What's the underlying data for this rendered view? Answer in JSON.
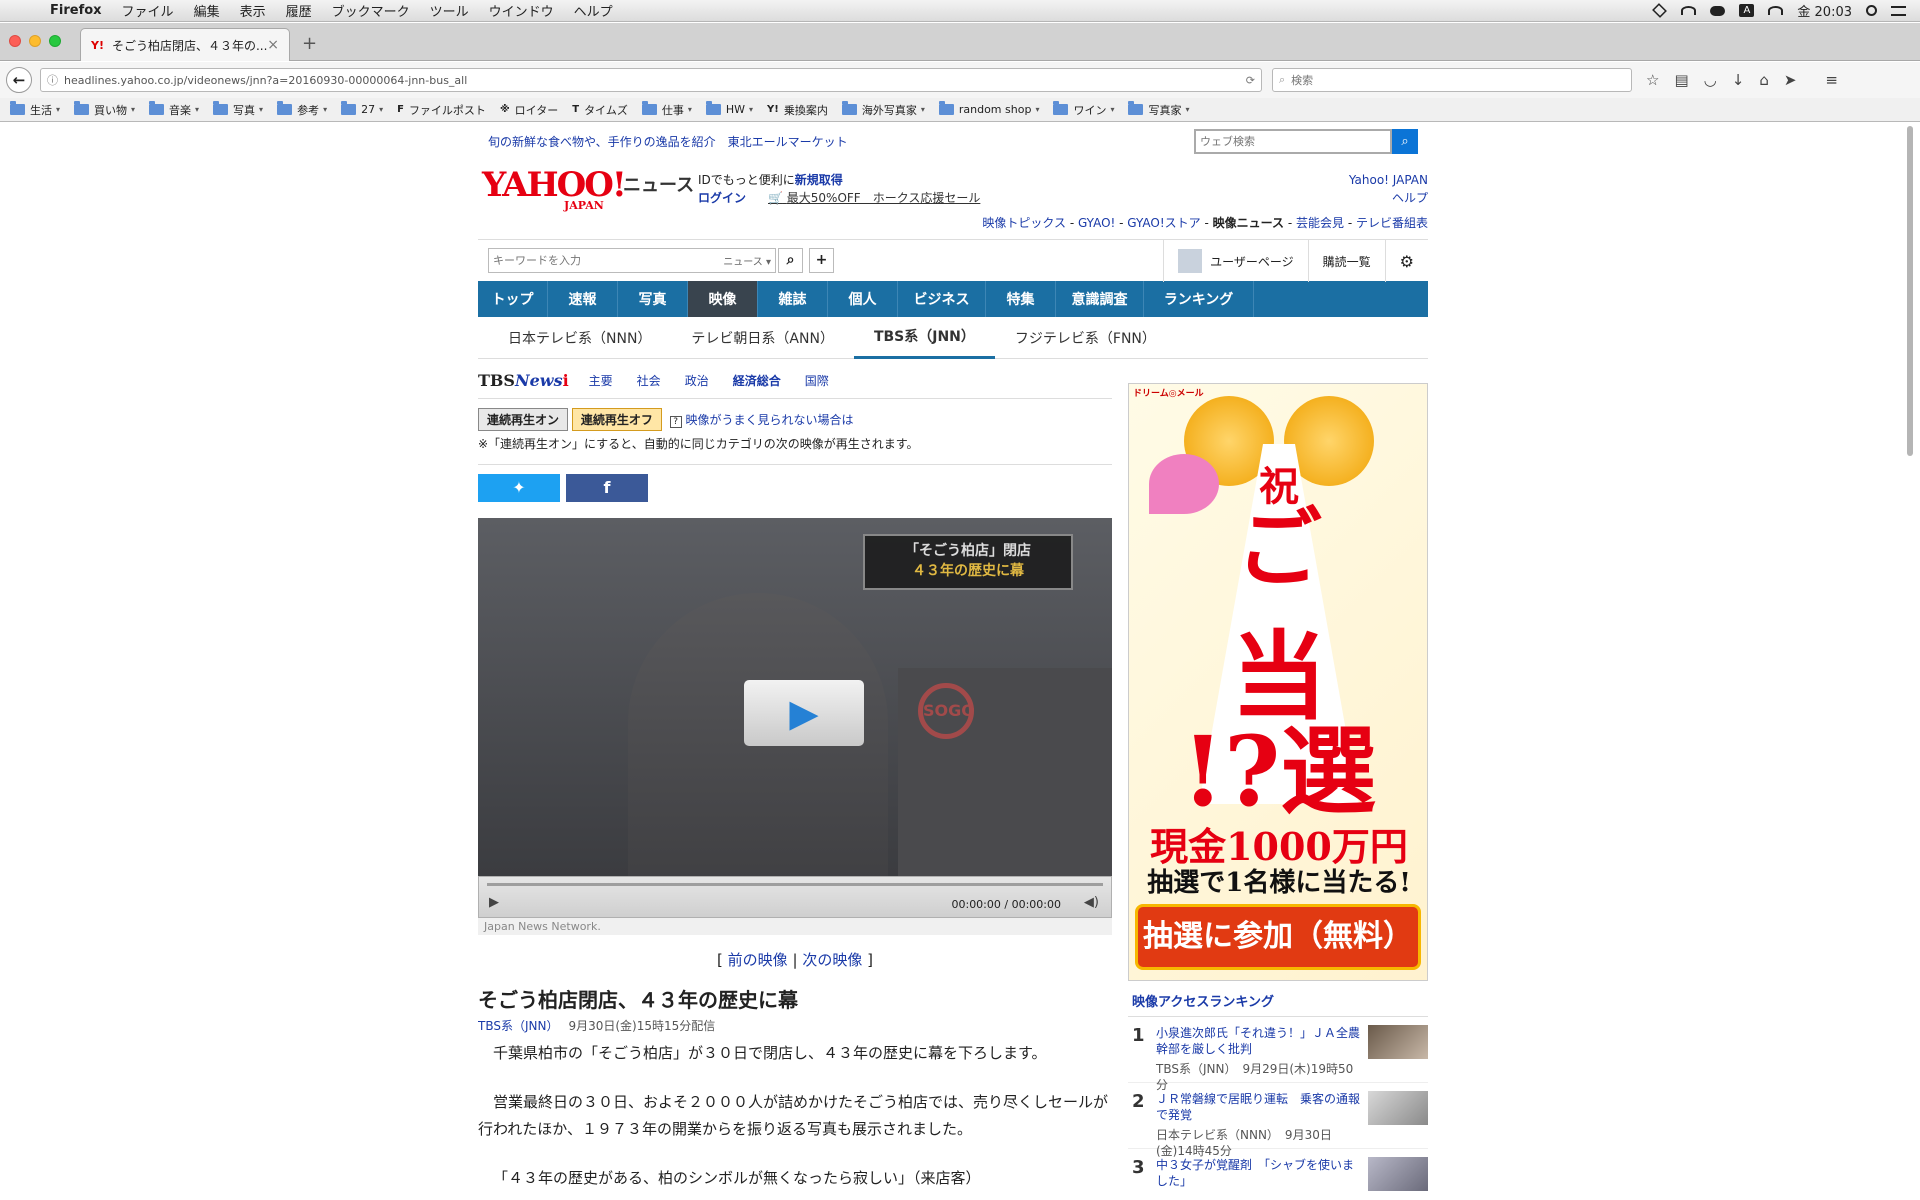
{
  "macbar": {
    "app": "Firefox",
    "menus": [
      "ファイル",
      "編集",
      "表示",
      "履歴",
      "ブックマーク",
      "ツール",
      "ウインドウ",
      "ヘルプ"
    ],
    "clock": "金 20:03",
    "input_icon": "A"
  },
  "browser": {
    "tab_title": "そごう柏店閉店、４３年の...",
    "favicon": "Y!",
    "url": "headlines.yahoo.co.jp/videonews/jnn?a=20160930-00000064-jnn-bus_all",
    "search_placeholder": "検索",
    "bookmarks": [
      {
        "label": "生活",
        "type": "folder"
      },
      {
        "label": "買い物",
        "type": "folder"
      },
      {
        "label": "音楽",
        "type": "folder"
      },
      {
        "label": "写真",
        "type": "folder"
      },
      {
        "label": "参考",
        "type": "folder"
      },
      {
        "label": "27",
        "type": "folder"
      },
      {
        "label": "ファイルポスト",
        "type": "site",
        "fav": "F"
      },
      {
        "label": "ロイター",
        "type": "site",
        "fav": "※"
      },
      {
        "label": "タイムズ",
        "type": "site",
        "fav": "T"
      },
      {
        "label": "仕事",
        "type": "folder"
      },
      {
        "label": "HW",
        "type": "folder"
      },
      {
        "label": "乗換案内",
        "type": "site",
        "fav": "Y!"
      },
      {
        "label": "海外写真家",
        "type": "folder"
      },
      {
        "label": "random shop",
        "type": "folder"
      },
      {
        "label": "ワイン",
        "type": "folder"
      },
      {
        "label": "写真家",
        "type": "folder"
      }
    ]
  },
  "promo": {
    "text": "旬の新鮮な食べ物や、手作りの逸品を紹介　東北エールマーケット",
    "websearch_placeholder": "ウェブ検索"
  },
  "header": {
    "logo": "YAHOO!",
    "logo_sub": "JAPAN",
    "service": "ニュース",
    "id_text": "IDでもっと便利に",
    "register": "新規取得",
    "login": "ログイン",
    "sale": "最大50%OFF　ホークス応援セール",
    "yahoo_japan": "Yahoo! JAPAN",
    "help": "ヘルプ",
    "links": [
      "映像トピックス",
      "GYAO!",
      "GYAO!ストア",
      "映像ニュース",
      "芸能会見",
      "テレビ番組表"
    ],
    "separator": " - "
  },
  "search": {
    "placeholder": "キーワードを入力",
    "category": "ニュース",
    "user_page": "ユーザーページ",
    "subscriptions": "購読一覧"
  },
  "mainnav": [
    "トップ",
    "速報",
    "写真",
    "映像",
    "雑誌",
    "個人",
    "ビジネス",
    "特集",
    "意識調査",
    "ランキング"
  ],
  "subnav": [
    "日本テレビ系（NNN）",
    "テレビ朝日系（ANN）",
    "TBS系（JNN）",
    "フジテレビ系（FNN）"
  ],
  "tbs": {
    "logo_a": "TBS",
    "logo_b": "News",
    "logo_c": "i",
    "categories": [
      "主要",
      "社会",
      "政治",
      "経済総合",
      "国際"
    ]
  },
  "playback": {
    "on": "連続再生オン",
    "off": "連続再生オフ",
    "help_link": "映像がうまく見られない場合は",
    "note": "※「連続再生オン」にすると、自動的に同じカテゴリの次の映像が再生されます。"
  },
  "video": {
    "caption_line1": "「そごう柏店」閉店",
    "caption_line2": "４３年の歴史に幕",
    "sign": "SOGO",
    "time": "00:00:00 / 00:00:00",
    "credit": "Japan News Network."
  },
  "pager": {
    "open": "[",
    "prev": "前の映像",
    "sep": "|",
    "next": "次の映像",
    "close": "]"
  },
  "article": {
    "headline": "そごう柏店閉店、４３年の歴史に幕",
    "source": "TBS系（JNN）",
    "date": "9月30日(金)15時15分配信",
    "p1": "千葉県柏市の「そごう柏店」が３０日で閉店し、４３年の歴史に幕を下ろします。",
    "p2": "営業最終日の３０日、およそ２０００人が詰めかけたそごう柏店では、売り尽くしセールが行われたほか、１９７３年の開業からを振り返る写真も展示されました。",
    "p3": "「４３年の歴史がある、柏のシンボルが無くなったら寂しい」（来店客）"
  },
  "ad": {
    "brand": "ドリーム◎メール",
    "line1": "祝",
    "line2": "ご",
    "line3": "当",
    "line4": "!?選",
    "money": "現金1000万円",
    "lottery": "抽選で1名様に当たる!",
    "cta": "抽選に参加（無料）"
  },
  "ranking": {
    "title": "映像アクセスランキング",
    "items": [
      {
        "num": "1",
        "title": "小泉進次郎氏「それ違う！」ＪＡ全農幹部を厳しく批判",
        "meta": "TBS系（JNN）　9月29日(木)19時50分"
      },
      {
        "num": "2",
        "title": "ＪＲ常磐線で居眠り運転　乗客の通報で発覚",
        "meta": "日本テレビ系（NNN）　9月30日(金)14時45分"
      },
      {
        "num": "3",
        "title": "中３女子が覚醒剤　「シャブを使いました」",
        "meta": ""
      }
    ]
  }
}
